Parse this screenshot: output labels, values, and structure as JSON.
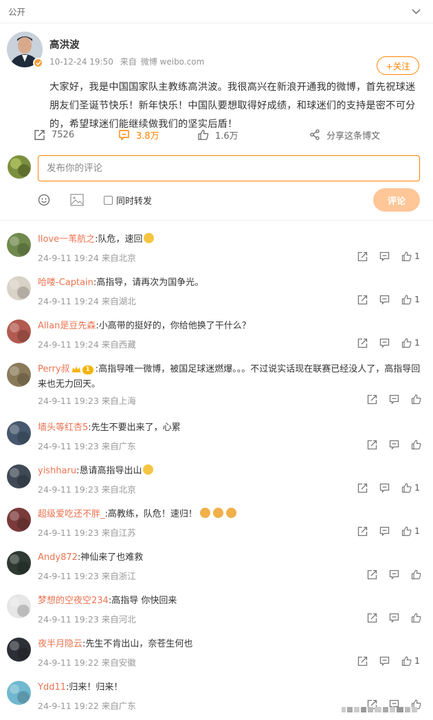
{
  "topbar": {
    "visibility": "公开"
  },
  "post": {
    "author": "高洪波",
    "time": "10-12-24 19:50",
    "source_prefix": "来自",
    "source": "微博 weibo.com",
    "follow_label": "+关注",
    "text": "大家好，我是中国国家队主教练高洪波。我很高兴在新浪开通我的微博，首先祝球迷朋友们圣诞节快乐！新年快乐！中国队要想取得好成绩，和球迷们的支持是密不可分的，希望球迷们能继续做我们的坚实后盾！",
    "actions": {
      "repost_count": "7526",
      "comment_count": "3.8万",
      "like_count": "1.6万",
      "share_label": "分享这条博文"
    }
  },
  "composer": {
    "placeholder": "发布你的评论",
    "forward_label": "同时转发",
    "submit_label": "评论"
  },
  "comments": [
    {
      "user": "Ilove一苇航之",
      "text": "队危，速回",
      "emoji": true,
      "time": "24-9-11 19:24",
      "location": "来自北京",
      "likes": "1",
      "avatar_color": "#6f8a4c"
    },
    {
      "user": "哈喽-Captain",
      "text": "高指导，请再次为国争光。",
      "time": "24-9-11 19:24",
      "location": "来自湖北",
      "likes": "1",
      "avatar_color": "#d9d2c6"
    },
    {
      "user": "Allan是豆先森",
      "text": "小高带的挺好的，你给他换了干什么？",
      "time": "24-9-11 19:24",
      "location": "来自西藏",
      "likes": "1",
      "avatar_color": "#b25a4f"
    },
    {
      "user": "Perry叔",
      "badge_level": "1",
      "text": "高指导唯一微博，被国足球迷燃爆。。。不过说实话现在联赛已经没人了，高指导回来也无力回天。",
      "time": "24-9-11 19:23",
      "location": "来自上海",
      "likes": "",
      "avatar_color": "#8a7a5a"
    },
    {
      "user": "墙头等红杏5",
      "text": "先生不要出来了，心累",
      "time": "24-9-11 19:23",
      "location": "来自广东",
      "likes": "",
      "avatar_color": "#46586e"
    },
    {
      "user": "yishharu",
      "text": "恳请高指导出山",
      "emoji": true,
      "time": "24-9-11 19:23",
      "location": "来自北京",
      "likes": "1",
      "avatar_color": "#3f4a56"
    },
    {
      "user": "超级爱吃还不胖_",
      "text": "高教练，队危！速归！",
      "emoji3": true,
      "time": "24-9-11 19:23",
      "location": "来自江苏",
      "likes": "1",
      "avatar_color": "#7a3a3a"
    },
    {
      "user": "Andy872",
      "text": "神仙来了也难救",
      "time": "24-9-11 19:23",
      "location": "来自浙江",
      "likes": "",
      "avatar_color": "#2e3a33"
    },
    {
      "user": "梦想的空夜空234",
      "text": "高指导 你快回来",
      "time": "24-9-11 19:23",
      "location": "来自河北",
      "likes": "",
      "avatar_color": "#e6e6e6"
    },
    {
      "user": "夜半月隐云",
      "text": "先生不肯出山，奈苍生何也",
      "time": "24-9-11 19:22",
      "location": "来自安徽",
      "likes": "1",
      "avatar_color": "#2c2f36"
    },
    {
      "user": "Ydd11",
      "text": "归来！归来！",
      "time": "24-9-11 19:22",
      "location": "来自广东",
      "likes": "",
      "avatar_color": "#6fb8cf"
    }
  ],
  "colors": {
    "accent": "#ff8200",
    "username": "#eb7350",
    "meta": "#999999"
  }
}
